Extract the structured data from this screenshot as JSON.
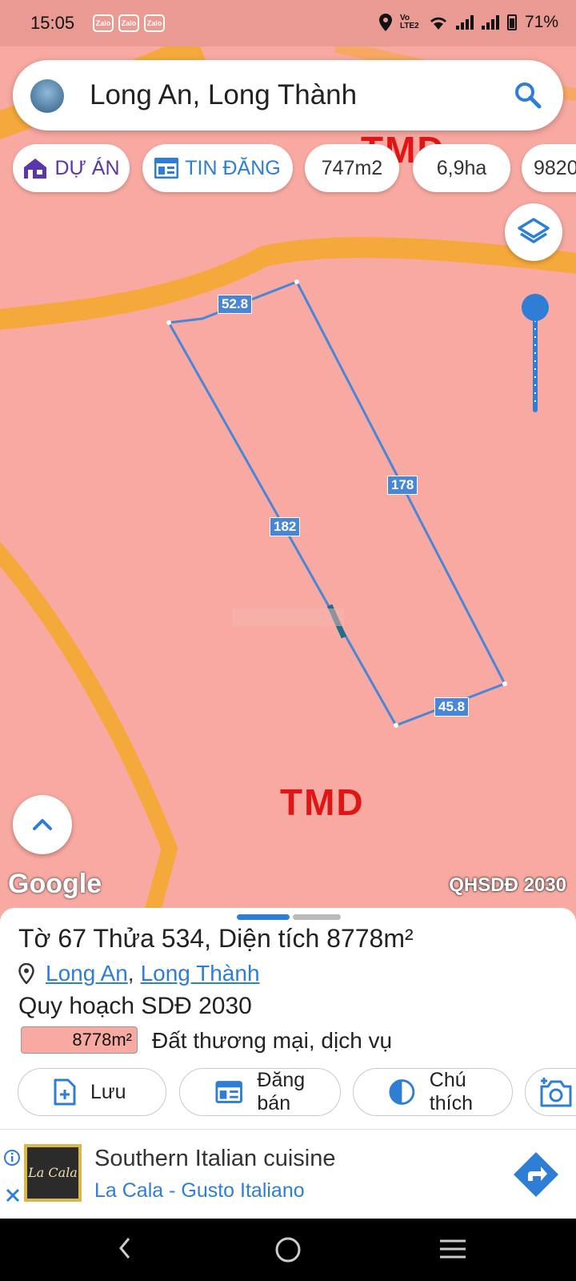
{
  "status_bar": {
    "time": "15:05",
    "zalo_icons": [
      "Zalo",
      "Zalo",
      "Zalo"
    ],
    "network": "Vo LTE2",
    "battery": "71%",
    "icons": [
      "location-icon",
      "wifi-icon",
      "signal-icon",
      "signal-icon",
      "battery-icon"
    ]
  },
  "search": {
    "query": "Long An, Long Thành"
  },
  "chips": {
    "du_an": "DỰ ÁN",
    "tin_dang": "TIN ĐĂNG",
    "area1": "747m2",
    "area2": "6,9ha",
    "area3": "9820"
  },
  "map": {
    "zone_label_top": "TMD",
    "zone_label_bottom": "TMD",
    "dimensions": {
      "top": "52.8",
      "right": "178",
      "left": "182",
      "bottom": "45.8"
    },
    "google": "Google",
    "layer_label": "QHSDĐ 2030",
    "zone_color": "#f8a9a1",
    "road_color": "#f6a93b",
    "boundary_color": "#4a86d8"
  },
  "sheet": {
    "title": "Tờ 67 Thửa 534, Diện tích 8778m²",
    "province": "Long An",
    "separator": ",",
    "district": "Long Thành",
    "plan": "Quy hoạch SDĐ 2030",
    "area_badge": "8778m²",
    "land_use": "Đất thương mại, dịch vụ",
    "actions": {
      "save": "Lưu",
      "post": "Đăng bán",
      "legend": "Chú thích"
    }
  },
  "ad": {
    "logo_text": "La Cala",
    "title": "Southern Italian cuisine",
    "subtitle": "La Cala - Gusto Italiano"
  }
}
